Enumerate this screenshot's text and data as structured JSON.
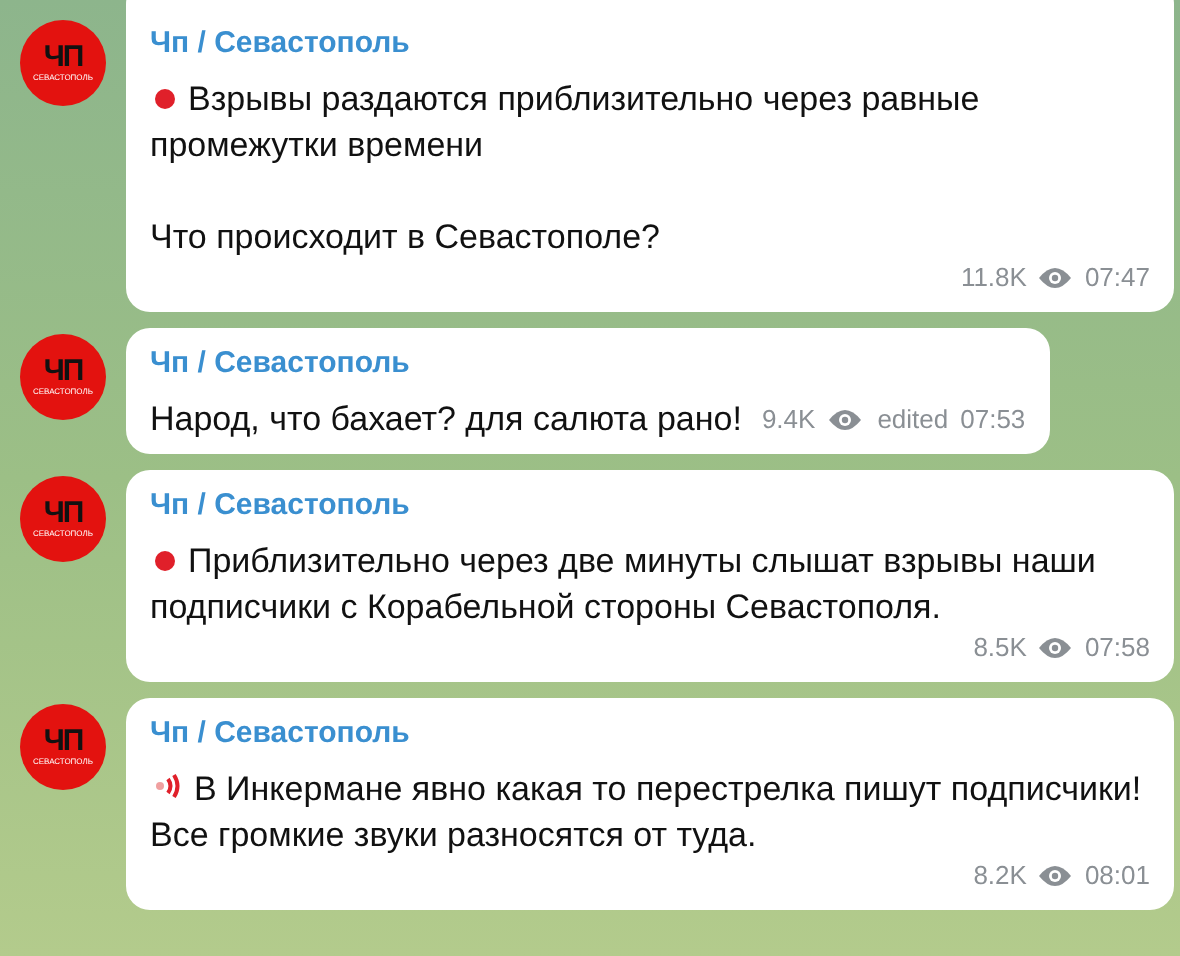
{
  "messages": [
    {
      "avatar": {
        "title": "ЧП",
        "subtitle": "СЕВАСТОПОЛЬ"
      },
      "author": "Чп / Севастополь",
      "kind": "dot",
      "paragraphs": [
        "Взрывы раздаются приблизительно через равные промежутки времени",
        "Что происходит в Севастополе?"
      ],
      "views": "11.8K",
      "time": "07:47"
    },
    {
      "avatar": {
        "title": "ЧП",
        "subtitle": "СЕВАСТОПОЛЬ"
      },
      "author": "Чп / Севастополь",
      "kind": "plain",
      "paragraphs": [
        "Народ, что бахает? для салюта рано!"
      ],
      "views": "9.4K",
      "edited_label": "edited",
      "time": "07:53"
    },
    {
      "avatar": {
        "title": "ЧП",
        "subtitle": "СЕВАСТОПОЛЬ"
      },
      "author": "Чп / Севастополь",
      "kind": "dot",
      "paragraphs": [
        "Приблизительно через две минуты слышат взрывы наши подписчики с Корабельной стороны Севастополя."
      ],
      "views": "8.5K",
      "time": "07:58"
    },
    {
      "avatar": {
        "title": "ЧП",
        "subtitle": "СЕВАСТОПОЛЬ"
      },
      "author": "Чп / Севастополь",
      "kind": "sound",
      "paragraphs": [
        "В Инкермане явно какая то перестрелка пишут подписчики! Все громкие звуки разносятся от туда."
      ],
      "views": "8.2K",
      "time": "08:01"
    }
  ]
}
